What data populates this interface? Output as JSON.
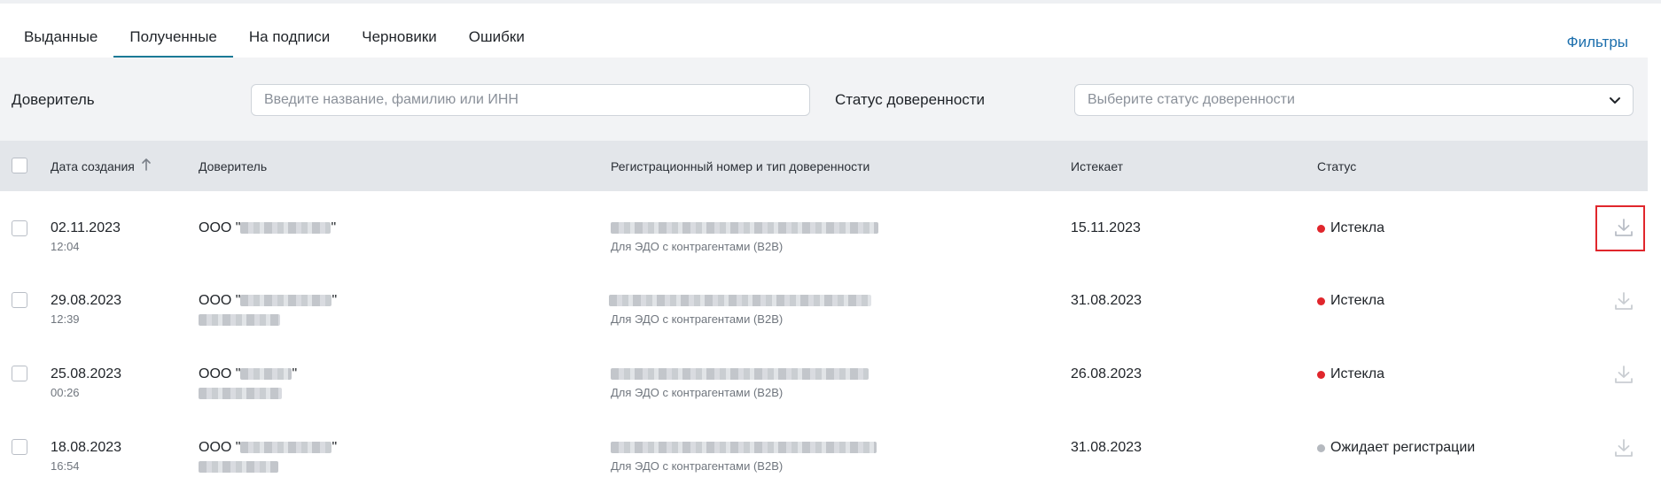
{
  "tabs": [
    {
      "label": "Выданные",
      "active": false
    },
    {
      "label": "Полученные",
      "active": true
    },
    {
      "label": "На подписи",
      "active": false
    },
    {
      "label": "Черновики",
      "active": false
    },
    {
      "label": "Ошибки",
      "active": false
    }
  ],
  "filters_link": "Фильтры",
  "filters": {
    "principal_label": "Доверитель",
    "principal_placeholder": "Введите название, фамилию или ИНН",
    "status_label": "Статус доверенности",
    "status_placeholder": "Выберите статус доверенности"
  },
  "table": {
    "headers": {
      "created": "Дата создания",
      "principal": "Доверитель",
      "reg": "Регистрационный номер и тип доверенности",
      "expires": "Истекает",
      "status": "Статус"
    },
    "rows": [
      {
        "date": "02.11.2023",
        "time": "12:04",
        "principal": "ООО \"",
        "principal_end": "\"",
        "type": "Для ЭДО с контрагентами (B2B)",
        "expires": "15.11.2023",
        "status": "Истекла",
        "status_color": "#e0262c"
      },
      {
        "date": "29.08.2023",
        "time": "12:39",
        "principal": "ООО \"",
        "principal_end": "\"",
        "type": "Для ЭДО с контрагентами (B2B)",
        "expires": "31.08.2023",
        "status": "Истекла",
        "status_color": "#e0262c"
      },
      {
        "date": "25.08.2023",
        "time": "00:26",
        "principal": "ООО \"",
        "principal_end": "\"",
        "type": "Для ЭДО с контрагентами (B2B)",
        "expires": "26.08.2023",
        "status": "Истекла",
        "status_color": "#e0262c"
      },
      {
        "date": "18.08.2023",
        "time": "16:54",
        "principal": "ООО \"",
        "principal_end": "\"",
        "type": "Для ЭДО с контрагентами (B2B)",
        "expires": "31.08.2023",
        "status": "Ожидает регистрации",
        "status_color": "#b5b9bf"
      }
    ]
  },
  "icons": {
    "sort": "arrow-up-icon",
    "download": "download-icon",
    "chevron": "chevron-down-icon"
  },
  "colors": {
    "accent": "#1b7a96",
    "link": "#1c6fad",
    "highlight": "#e0262c"
  }
}
